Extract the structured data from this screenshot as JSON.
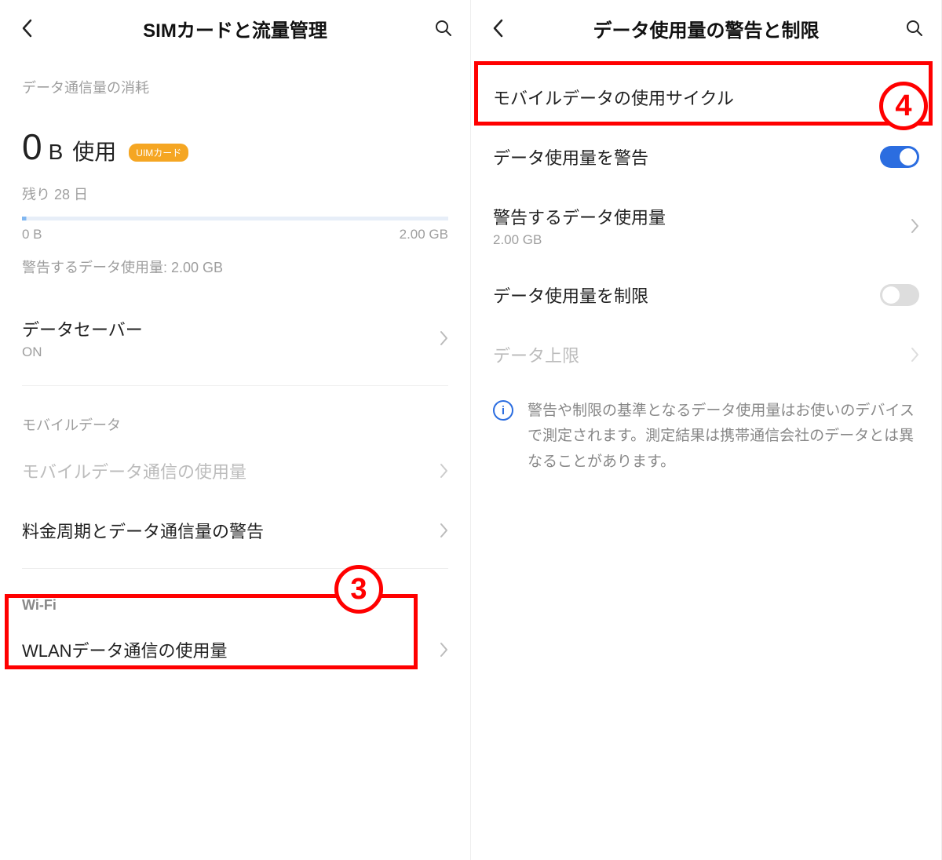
{
  "left": {
    "header_title": "SIMカードと流量管理",
    "section_data_usage": "データ通信量の消耗",
    "usage_number": "0",
    "usage_unit": "B",
    "usage_label": "使用",
    "badge_text": "UIMカード",
    "remaining": "残り 28 日",
    "scale_min": "0 B",
    "scale_max": "2.00 GB",
    "warning_line": "警告するデータ使用量: 2.00 GB",
    "row_datasaver_title": "データセーバー",
    "row_datasaver_sub": "ON",
    "section_mobile": "モバイルデータ",
    "row_mobile_usage": "モバイルデータ通信の使用量",
    "row_billing_warning": "料金周期とデータ通信量の警告",
    "section_wifi": "Wi-Fi",
    "row_wlan_usage": "WLANデータ通信の使用量",
    "annotation_number": "3"
  },
  "right": {
    "header_title": "データ使用量の警告と制限",
    "row_cycle": "モバイルデータの使用サイクル",
    "row_warn_toggle": "データ使用量を警告",
    "row_warn_amount_title": "警告するデータ使用量",
    "row_warn_amount_sub": "2.00 GB",
    "row_limit_toggle": "データ使用量を制限",
    "row_data_cap": "データ上限",
    "info_text": "警告や制限の基準となるデータ使用量はお使いのデバイスで測定されます。測定結果は携帯通信会社のデータとは異なることがあります。",
    "annotation_number": "4"
  }
}
